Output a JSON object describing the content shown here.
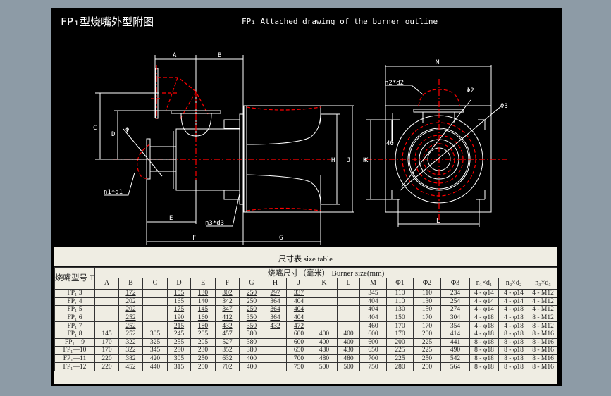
{
  "title_cn": "FP₁型烧嘴外型附图",
  "title_en": "FP₁ Attached drawing of the burner outline",
  "drawing_labels": {
    "A": "A",
    "B": "B",
    "C": "C",
    "D": "D",
    "E": "E",
    "F": "F",
    "G": "G",
    "H": "H",
    "J": "J",
    "K": "K",
    "K2": "K",
    "L": "L",
    "M": "M",
    "n1d1": "n1*d1",
    "n2d2": "n2*d2",
    "n3d3": "n3*d3",
    "phi": "Φ",
    "phi2": "Φ2",
    "phi3": "Φ3",
    "dim40": "40"
  },
  "colors": {
    "background": "#8d9ba6",
    "sheet": "#000000",
    "line": "#ffffff",
    "centerline": "#ff0000",
    "table_bg": "#efede3"
  },
  "table": {
    "title": "尺寸表  size table",
    "type_header": "烧嘴型号 Type",
    "size_header": "烧嘴尺寸（毫米） Burner size(mm)",
    "columns": [
      "A",
      "B",
      "C",
      "D",
      "E",
      "F",
      "G",
      "H",
      "J",
      "K",
      "L",
      "M",
      "Φ1",
      "Φ2",
      "Φ3",
      "n₁×d₁",
      "n₂×d₂",
      "n₃×d₃"
    ],
    "rows": [
      [
        "FP₁  3",
        "",
        "172",
        "",
        "155",
        "130",
        "302",
        "250",
        "297",
        "337",
        "",
        "",
        "345",
        "110",
        "110",
        "234",
        "4 - φ14",
        "4 - φ14",
        "4 - M12"
      ],
      [
        "FP₁  4",
        "",
        "202",
        "",
        "165",
        "140",
        "342",
        "250",
        "364",
        "404",
        "",
        "",
        "404",
        "110",
        "130",
        "254",
        "4 - φ14",
        "4 - φ14",
        "4 - M12"
      ],
      [
        "FP₁  5",
        "",
        "202",
        "",
        "175",
        "145",
        "347",
        "250",
        "364",
        "404",
        "",
        "",
        "404",
        "130",
        "150",
        "274",
        "4 - φ14",
        "4 - φ18",
        "4 - M12"
      ],
      [
        "FP₁  6",
        "",
        "252",
        "",
        "190",
        "160",
        "412",
        "350",
        "364",
        "404",
        "",
        "",
        "404",
        "150",
        "170",
        "304",
        "4 - φ18",
        "4 - φ18",
        "8 - M12"
      ],
      [
        "FP₁  7",
        "",
        "252",
        "",
        "215",
        "180",
        "432",
        "350",
        "432",
        "472",
        "",
        "",
        "460",
        "170",
        "170",
        "354",
        "4 - φ18",
        "4 - φ18",
        "8 - M12"
      ],
      [
        "FP₁  8",
        "145",
        "252",
        "305",
        "245",
        "205",
        "457",
        "380",
        "",
        "600",
        "400",
        "400",
        "600",
        "170",
        "200",
        "414",
        "4 - φ18",
        "8 - φ18",
        "8 - M16"
      ],
      [
        "FP₁—9",
        "170",
        "322",
        "325",
        "255",
        "205",
        "527",
        "380",
        "",
        "600",
        "400",
        "400",
        "600",
        "200",
        "225",
        "441",
        "8 - φ18",
        "8 - φ18",
        "8 - M16"
      ],
      [
        "FP₁—10",
        "170",
        "322",
        "345",
        "280",
        "230",
        "352",
        "380",
        "",
        "650",
        "430",
        "430",
        "650",
        "225",
        "225",
        "490",
        "8 - φ18",
        "8 - φ18",
        "8 - M16"
      ],
      [
        "FP₁—11",
        "220",
        "382",
        "420",
        "305",
        "250",
        "632",
        "400",
        "",
        "700",
        "480",
        "480",
        "700",
        "225",
        "250",
        "542",
        "8 - φ18",
        "8 - φ18",
        "8 - M16"
      ],
      [
        "FP₁—12",
        "220",
        "452",
        "440",
        "315",
        "250",
        "702",
        "400",
        "",
        "750",
        "500",
        "500",
        "750",
        "280",
        "250",
        "564",
        "8 - φ18",
        "8 - φ18",
        "8 - M16"
      ]
    ]
  }
}
